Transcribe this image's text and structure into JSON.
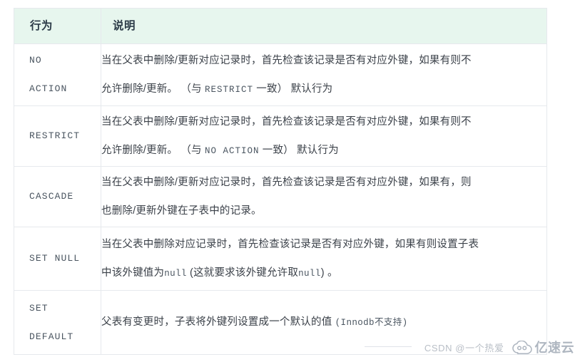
{
  "table": {
    "headers": {
      "action": "行为",
      "description": "说明"
    },
    "rows": [
      {
        "action_line1": "NO",
        "action_line2": "ACTION",
        "desc_line1": "当在父表中删除/更新对应记录时，首先检查该记录是否有对应外键，如果有则不",
        "desc_line2_a": "允许删除/更新。 （与 ",
        "desc_line2_code": "RESTRICT",
        "desc_line2_b": " 一致） 默认行为"
      },
      {
        "action_line1": "RESTRICT",
        "action_line2": "",
        "desc_line1": "当在父表中删除/更新对应记录时，首先检查该记录是否有对应外键，如果有则不",
        "desc_line2_a": "允许删除/更新。 （与 ",
        "desc_line2_code": "NO ACTION",
        "desc_line2_b": " 一致） 默认行为"
      },
      {
        "action_line1": "CASCADE",
        "action_line2": "",
        "desc_line1": "当在父表中删除/更新对应记录时，首先检查该记录是否有对应外键，如果有，则",
        "desc_line2_a": "也删除/更新外键在子表中的记录。",
        "desc_line2_code": "",
        "desc_line2_b": ""
      },
      {
        "action_line1": "SET NULL",
        "action_line2": "",
        "desc_line1": "当在父表中删除对应记录时，首先检查该记录是否有对应外键，如果有则设置子表",
        "desc_line2_a": "中该外键值为",
        "desc_line2_code": "null",
        "desc_line2_b": " (这就要求该外键允许取",
        "desc_line2_code2": "null",
        "desc_line2_c": ") 。"
      },
      {
        "action_line1": "SET",
        "action_line2": "DEFAULT",
        "desc_line1": "父表有变更时，子表将外键列设置成一个默认的值 ",
        "desc_line1_code": "(Innodb不支持)",
        "desc_line2_a": "",
        "desc_line2_code": "",
        "desc_line2_b": ""
      }
    ]
  },
  "watermark": {
    "csdn_text": "CSDN @一个热爱",
    "brand_text": "亿速云",
    "cloud_icon": "cloud-icon"
  },
  "colors": {
    "header_bg": "#e7f6ee",
    "border": "#e6e9ed",
    "body_text": "#3b4149",
    "code_text": "#4a5560",
    "watermark_text": "#b9bfc7"
  }
}
